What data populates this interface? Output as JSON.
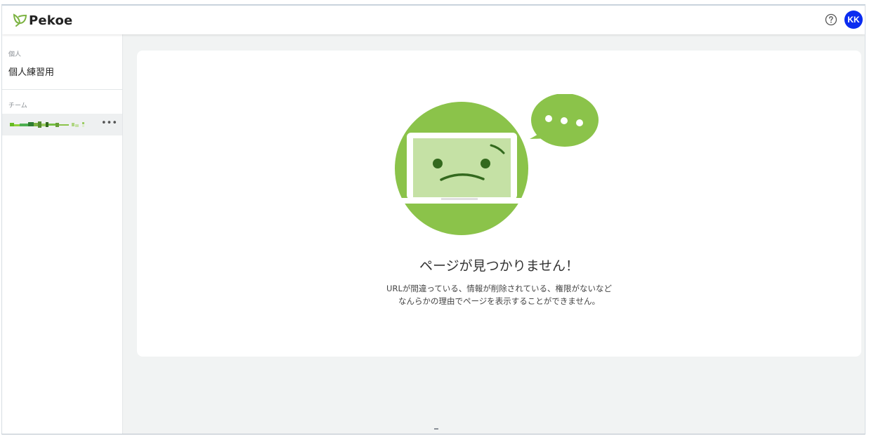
{
  "app": {
    "name": "Pekoe",
    "brand_color": "#7cb342"
  },
  "header": {
    "help_icon": "help-circle-icon",
    "avatar_initials": "KK",
    "avatar_color": "#0a2cf0"
  },
  "sidebar": {
    "personal_section_label": "個人",
    "personal_items": [
      {
        "label": "個人練習用"
      }
    ],
    "team_section_label": "チーム",
    "team_items": [
      {
        "label_redacted": true,
        "more_icon": "more-horizontal-icon",
        "more_label": "•••"
      }
    ]
  },
  "main": {
    "illustration_icon": "sad-laptop-icon",
    "speech_bubble_icon": "speech-bubble-icon",
    "title": "ページが見つかりません！",
    "description_line1": "URLが間違っている、情報が削除されている、権限がないなど",
    "description_line2": "なんらかの理由でページを表示することができません。",
    "illustration_colors": {
      "circle": "#8bc34a",
      "screen": "#c5e1a5",
      "laptop": "#ffffff",
      "face": "#33691e"
    }
  }
}
